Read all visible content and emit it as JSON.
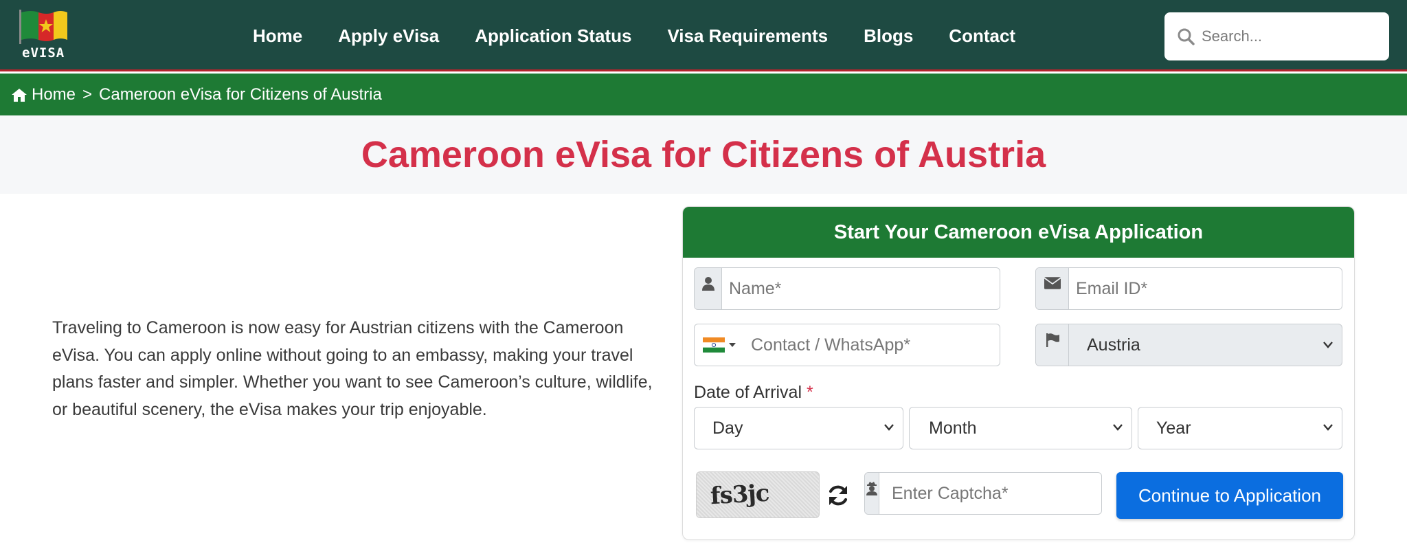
{
  "logo": {
    "text": "eVISA"
  },
  "nav": {
    "items": [
      {
        "label": "Home"
      },
      {
        "label": "Apply eVisa"
      },
      {
        "label": "Application Status"
      },
      {
        "label": "Visa Requirements"
      },
      {
        "label": "Blogs"
      },
      {
        "label": "Contact"
      }
    ]
  },
  "search": {
    "placeholder": "Search..."
  },
  "breadcrumb": {
    "home": "Home",
    "separator": ">",
    "current": "Cameroon eVisa for Citizens of Austria"
  },
  "page": {
    "title": "Cameroon eVisa for Citizens of Austria",
    "intro": "Traveling to Cameroon is now easy for Austrian citizens with the Cameroon eVisa. You can apply online without going to an embassy, making your travel plans faster and simpler. Whether you want to see Cameroon’s culture, wildlife, or beautiful scenery, the eVisa makes your trip enjoyable."
  },
  "form": {
    "heading": "Start Your Cameroon eVisa Application",
    "name_placeholder": "Name*",
    "email_placeholder": "Email ID*",
    "phone_placeholder": "Contact / WhatsApp*",
    "country_value": "Austria",
    "arrival_label": "Date of Arrival",
    "arrival_required": "*",
    "day_value": "Day",
    "month_value": "Month",
    "year_value": "Year",
    "captcha_text": "fs3jc",
    "captcha_placeholder": "Enter Captcha*",
    "submit_label": "Continue to Application"
  },
  "colors": {
    "header_bg": "#1e4a42",
    "breadcrumb_bg": "#1e7a34",
    "title_red": "#d4304a",
    "button_blue": "#0b6ee0"
  },
  "icons": [
    "cameroon-flag-logo-icon",
    "search-icon",
    "home-icon",
    "user-icon",
    "envelope-icon",
    "india-flag-icon",
    "flag-icon",
    "user-secret-icon",
    "refresh-icon",
    "chevron-down-icon"
  ]
}
